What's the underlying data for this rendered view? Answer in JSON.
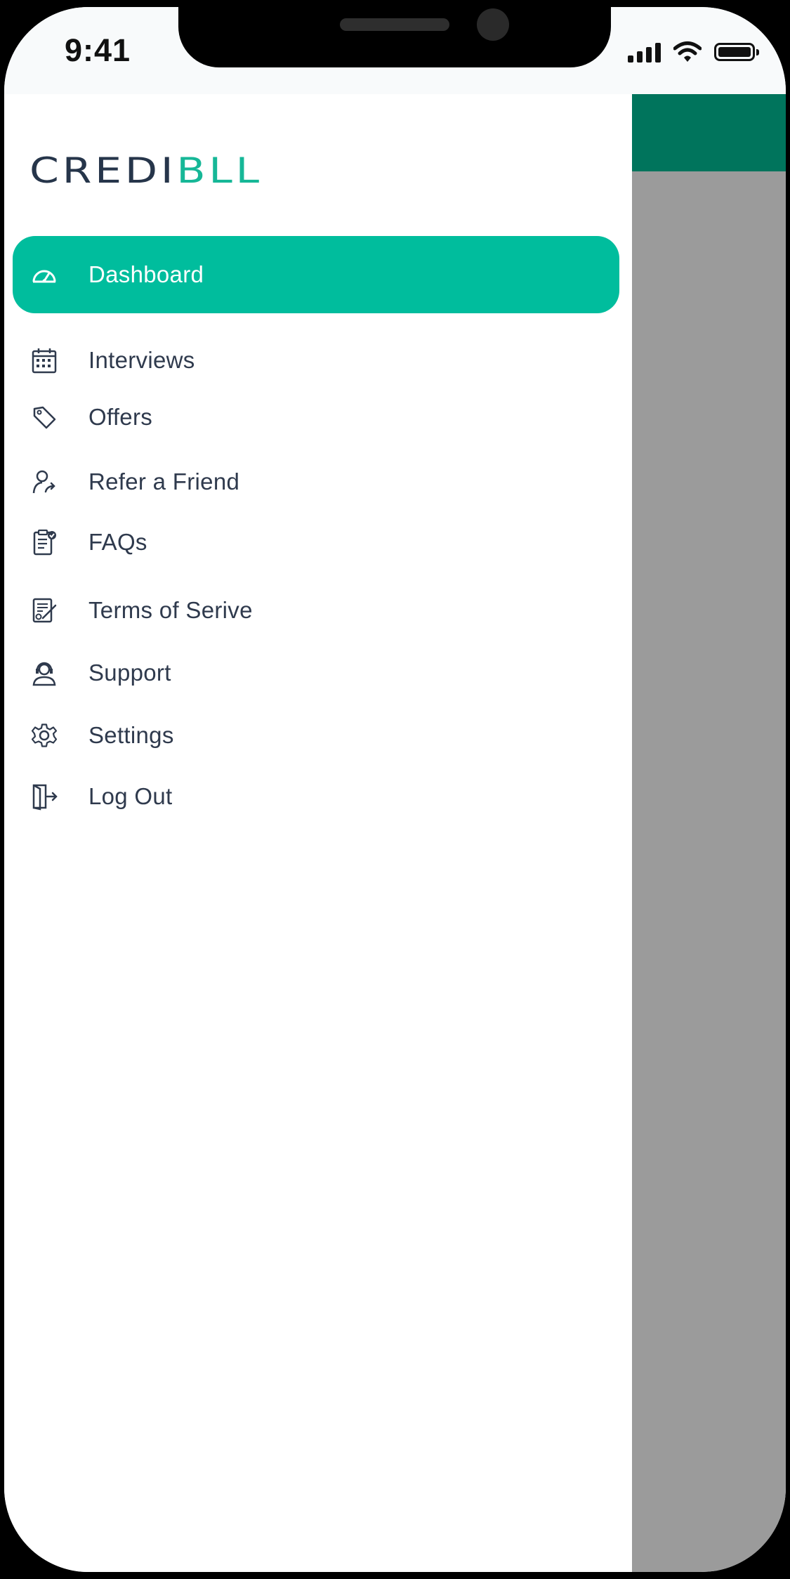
{
  "status_bar": {
    "time": "9:41"
  },
  "brand": {
    "part1": "CREDI",
    "part2": "BLL",
    "color_dark": "#26354a",
    "color_accent": "#16b797"
  },
  "menu": {
    "items": [
      {
        "label": "Dashboard",
        "icon": "speedometer-icon",
        "active": true
      },
      {
        "label": "Interviews",
        "icon": "calendar-icon"
      },
      {
        "label": "Offers",
        "icon": "tag-icon"
      },
      {
        "label": "Refer a Friend",
        "icon": "user-share-icon"
      },
      {
        "label": "FAQs",
        "icon": "clipboard-check-icon"
      },
      {
        "label": "Terms of Serive",
        "icon": "document-sign-icon"
      },
      {
        "label": "Support",
        "icon": "headset-icon"
      },
      {
        "label": "Settings",
        "icon": "gear-icon"
      },
      {
        "label": "Log Out",
        "icon": "logout-icon"
      }
    ]
  },
  "colors": {
    "active_bg": "#00bd9d",
    "header_bg": "#00745c",
    "overlay": "#9b9b9b"
  }
}
